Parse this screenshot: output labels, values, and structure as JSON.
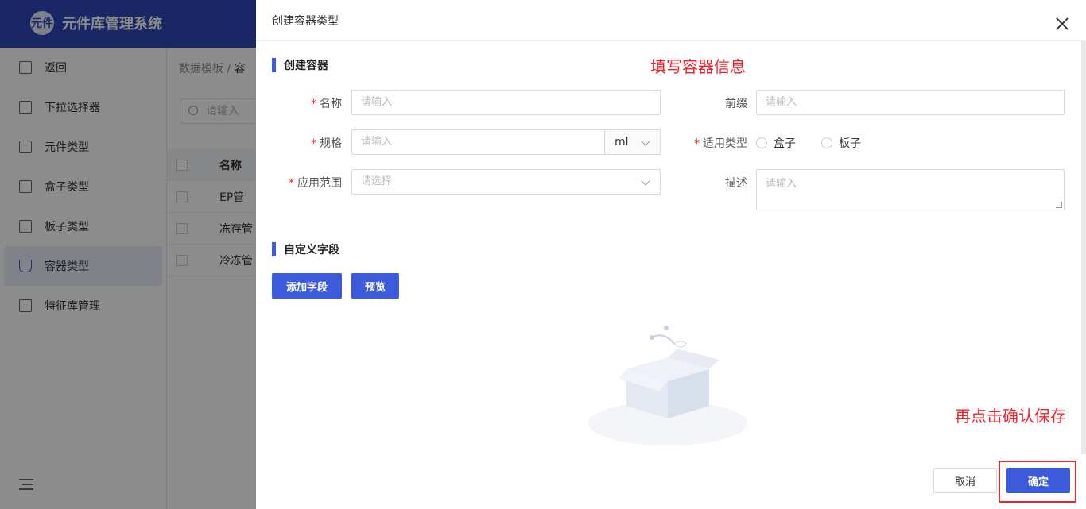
{
  "app": {
    "title": "元件库管理系统",
    "logo_text": "元件"
  },
  "sidebar": {
    "items": [
      {
        "label": "返回"
      },
      {
        "label": "下拉选择器"
      },
      {
        "label": "元件类型"
      },
      {
        "label": "盒子类型"
      },
      {
        "label": "板子类型"
      },
      {
        "label": "容器类型"
      },
      {
        "label": "特征库管理"
      }
    ],
    "active_index": 5
  },
  "background": {
    "breadcrumb": "数据模板",
    "breadcrumb_sep": "/",
    "breadcrumb_current": "容",
    "search_placeholder": "请输入",
    "table_header": "名称",
    "rows": [
      "EP管",
      "冻存管",
      "冷冻管"
    ]
  },
  "drawer": {
    "title": "创建容器类型",
    "section_create": "创建容器",
    "annotation_fill": "填写容器信息",
    "form": {
      "name_label": "名称",
      "name_placeholder": "请输入",
      "prefix_label": "前缀",
      "prefix_placeholder": "请输入",
      "spec_label": "规格",
      "spec_placeholder": "请输入",
      "spec_unit": "ml",
      "type_label": "适用类型",
      "type_options": [
        "盒子",
        "板子"
      ],
      "scope_label": "应用范围",
      "scope_placeholder": "请选择",
      "desc_label": "描述",
      "desc_placeholder": "请输入",
      "required_mark": "*"
    },
    "section_custom": "自定义字段",
    "add_field_button": "添加字段",
    "preview_button": "预览",
    "annotation_confirm": "再点击确认保存",
    "cancel_button": "取消",
    "confirm_button": "确定"
  },
  "colors": {
    "primary": "#3b5bdb",
    "header": "#2f47b8",
    "annotation": "#f5222d"
  }
}
